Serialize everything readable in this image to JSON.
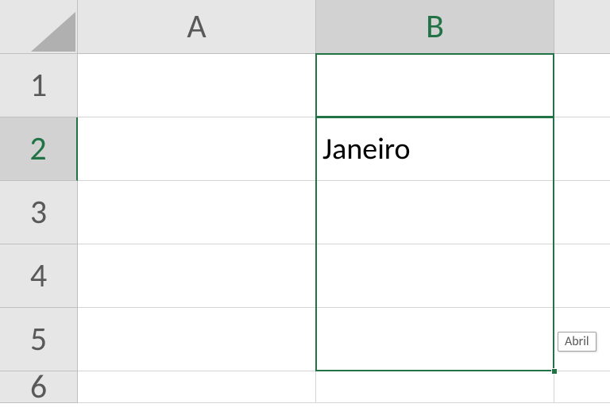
{
  "columns": [
    "A",
    "B"
  ],
  "rows": [
    "1",
    "2",
    "3",
    "4",
    "5",
    "6"
  ],
  "active_column_index": 1,
  "active_row_index": 1,
  "cells": {
    "B2": "Janeiro"
  },
  "fill_tooltip": "Abril",
  "selection": {
    "start": "B2",
    "end": "B5"
  }
}
